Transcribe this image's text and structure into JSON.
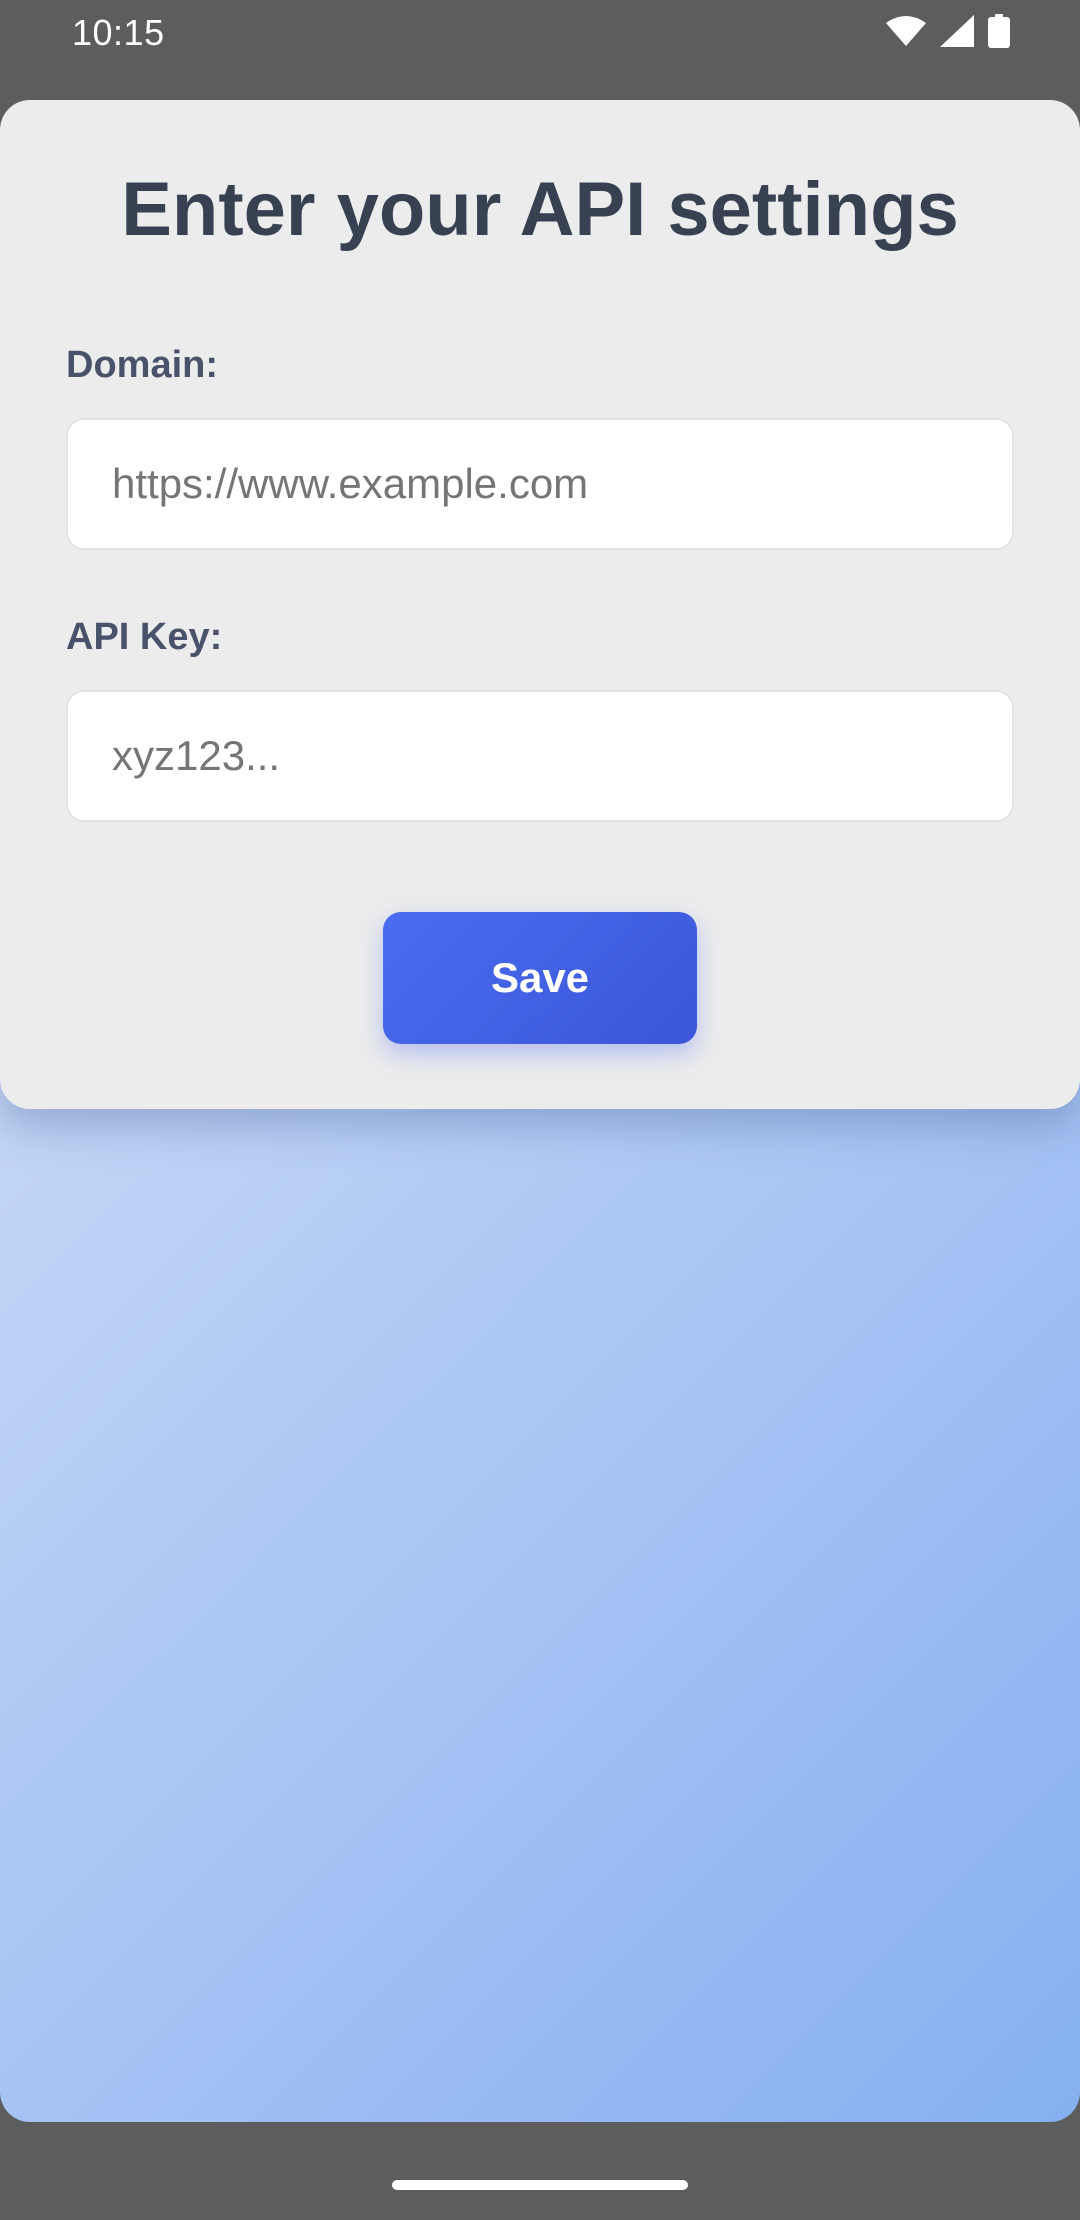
{
  "status_bar": {
    "time": "10:15",
    "icons": [
      "wifi-icon",
      "signal-icon",
      "battery-icon"
    ]
  },
  "settings_form": {
    "title": "Enter your API settings",
    "domain_label": "Domain:",
    "domain_placeholder": "https://www.example.com",
    "domain_value": "",
    "api_key_label": "API Key:",
    "api_key_placeholder": "xyz123...",
    "api_key_value": "",
    "save_label": "Save"
  },
  "colors": {
    "accent": "#4a6cf0",
    "title_text": "#374151",
    "label_text": "#48526a",
    "card_background": "#ececed",
    "system_bar": "#5d5d5d"
  }
}
